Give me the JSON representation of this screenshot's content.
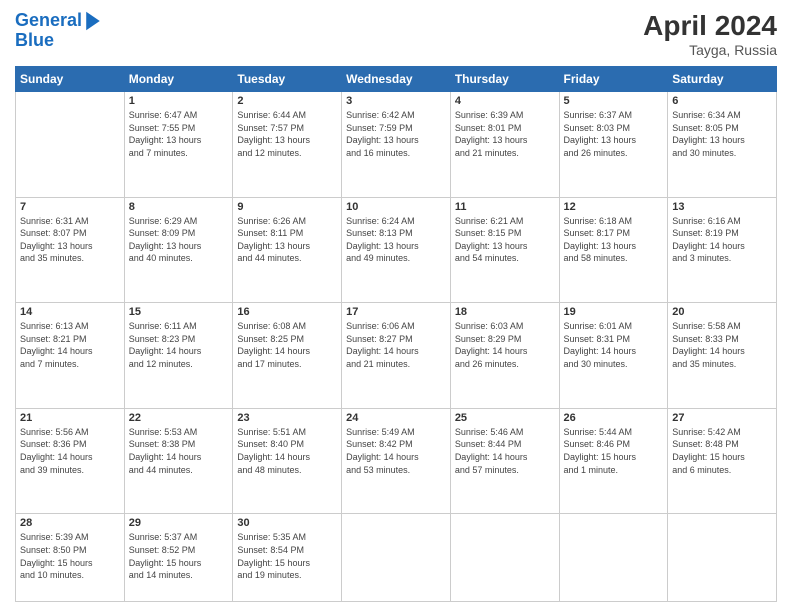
{
  "header": {
    "logo_line1": "General",
    "logo_line2": "Blue",
    "month_title": "April 2024",
    "location": "Tayga, Russia"
  },
  "weekdays": [
    "Sunday",
    "Monday",
    "Tuesday",
    "Wednesday",
    "Thursday",
    "Friday",
    "Saturday"
  ],
  "weeks": [
    [
      {
        "day": "",
        "info": ""
      },
      {
        "day": "1",
        "info": "Sunrise: 6:47 AM\nSunset: 7:55 PM\nDaylight: 13 hours\nand 7 minutes."
      },
      {
        "day": "2",
        "info": "Sunrise: 6:44 AM\nSunset: 7:57 PM\nDaylight: 13 hours\nand 12 minutes."
      },
      {
        "day": "3",
        "info": "Sunrise: 6:42 AM\nSunset: 7:59 PM\nDaylight: 13 hours\nand 16 minutes."
      },
      {
        "day": "4",
        "info": "Sunrise: 6:39 AM\nSunset: 8:01 PM\nDaylight: 13 hours\nand 21 minutes."
      },
      {
        "day": "5",
        "info": "Sunrise: 6:37 AM\nSunset: 8:03 PM\nDaylight: 13 hours\nand 26 minutes."
      },
      {
        "day": "6",
        "info": "Sunrise: 6:34 AM\nSunset: 8:05 PM\nDaylight: 13 hours\nand 30 minutes."
      }
    ],
    [
      {
        "day": "7",
        "info": "Sunrise: 6:31 AM\nSunset: 8:07 PM\nDaylight: 13 hours\nand 35 minutes."
      },
      {
        "day": "8",
        "info": "Sunrise: 6:29 AM\nSunset: 8:09 PM\nDaylight: 13 hours\nand 40 minutes."
      },
      {
        "day": "9",
        "info": "Sunrise: 6:26 AM\nSunset: 8:11 PM\nDaylight: 13 hours\nand 44 minutes."
      },
      {
        "day": "10",
        "info": "Sunrise: 6:24 AM\nSunset: 8:13 PM\nDaylight: 13 hours\nand 49 minutes."
      },
      {
        "day": "11",
        "info": "Sunrise: 6:21 AM\nSunset: 8:15 PM\nDaylight: 13 hours\nand 54 minutes."
      },
      {
        "day": "12",
        "info": "Sunrise: 6:18 AM\nSunset: 8:17 PM\nDaylight: 13 hours\nand 58 minutes."
      },
      {
        "day": "13",
        "info": "Sunrise: 6:16 AM\nSunset: 8:19 PM\nDaylight: 14 hours\nand 3 minutes."
      }
    ],
    [
      {
        "day": "14",
        "info": "Sunrise: 6:13 AM\nSunset: 8:21 PM\nDaylight: 14 hours\nand 7 minutes."
      },
      {
        "day": "15",
        "info": "Sunrise: 6:11 AM\nSunset: 8:23 PM\nDaylight: 14 hours\nand 12 minutes."
      },
      {
        "day": "16",
        "info": "Sunrise: 6:08 AM\nSunset: 8:25 PM\nDaylight: 14 hours\nand 17 minutes."
      },
      {
        "day": "17",
        "info": "Sunrise: 6:06 AM\nSunset: 8:27 PM\nDaylight: 14 hours\nand 21 minutes."
      },
      {
        "day": "18",
        "info": "Sunrise: 6:03 AM\nSunset: 8:29 PM\nDaylight: 14 hours\nand 26 minutes."
      },
      {
        "day": "19",
        "info": "Sunrise: 6:01 AM\nSunset: 8:31 PM\nDaylight: 14 hours\nand 30 minutes."
      },
      {
        "day": "20",
        "info": "Sunrise: 5:58 AM\nSunset: 8:33 PM\nDaylight: 14 hours\nand 35 minutes."
      }
    ],
    [
      {
        "day": "21",
        "info": "Sunrise: 5:56 AM\nSunset: 8:36 PM\nDaylight: 14 hours\nand 39 minutes."
      },
      {
        "day": "22",
        "info": "Sunrise: 5:53 AM\nSunset: 8:38 PM\nDaylight: 14 hours\nand 44 minutes."
      },
      {
        "day": "23",
        "info": "Sunrise: 5:51 AM\nSunset: 8:40 PM\nDaylight: 14 hours\nand 48 minutes."
      },
      {
        "day": "24",
        "info": "Sunrise: 5:49 AM\nSunset: 8:42 PM\nDaylight: 14 hours\nand 53 minutes."
      },
      {
        "day": "25",
        "info": "Sunrise: 5:46 AM\nSunset: 8:44 PM\nDaylight: 14 hours\nand 57 minutes."
      },
      {
        "day": "26",
        "info": "Sunrise: 5:44 AM\nSunset: 8:46 PM\nDaylight: 15 hours\nand 1 minute."
      },
      {
        "day": "27",
        "info": "Sunrise: 5:42 AM\nSunset: 8:48 PM\nDaylight: 15 hours\nand 6 minutes."
      }
    ],
    [
      {
        "day": "28",
        "info": "Sunrise: 5:39 AM\nSunset: 8:50 PM\nDaylight: 15 hours\nand 10 minutes."
      },
      {
        "day": "29",
        "info": "Sunrise: 5:37 AM\nSunset: 8:52 PM\nDaylight: 15 hours\nand 14 minutes."
      },
      {
        "day": "30",
        "info": "Sunrise: 5:35 AM\nSunset: 8:54 PM\nDaylight: 15 hours\nand 19 minutes."
      },
      {
        "day": "",
        "info": ""
      },
      {
        "day": "",
        "info": ""
      },
      {
        "day": "",
        "info": ""
      },
      {
        "day": "",
        "info": ""
      }
    ]
  ]
}
